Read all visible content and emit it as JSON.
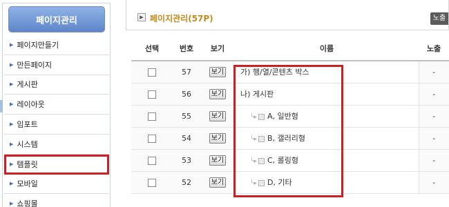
{
  "sidebar": {
    "title": "페이지관리",
    "items": [
      {
        "label": "페이지만들기"
      },
      {
        "label": "만든페이지"
      },
      {
        "label": "게시판"
      },
      {
        "label": "레이아웃"
      },
      {
        "label": "임포트"
      },
      {
        "label": "시스템"
      },
      {
        "label": "템플릿",
        "highlighted": true
      },
      {
        "label": "모바일"
      },
      {
        "label": "쇼핑몰"
      }
    ]
  },
  "header": {
    "title": "페이지관리(57P)",
    "right_button": "노출"
  },
  "table": {
    "columns": [
      "선택",
      "번호",
      "보기",
      "이름",
      "노출"
    ],
    "view_label": "보기",
    "rows": [
      {
        "num": "57",
        "name": "가) 행/열/콘텐츠 박스",
        "child": false,
        "expose": "-"
      },
      {
        "num": "56",
        "name": "나) 게시판",
        "child": false,
        "expose": "-"
      },
      {
        "num": "55",
        "name": "A, 일반형",
        "child": true,
        "expose": "-"
      },
      {
        "num": "54",
        "name": "B, 갤러리형",
        "child": true,
        "expose": "-"
      },
      {
        "num": "53",
        "name": "C, 롤링형",
        "child": true,
        "expose": "-"
      },
      {
        "num": "52",
        "name": "D, 기타",
        "child": true,
        "expose": "-"
      }
    ]
  },
  "colors": {
    "highlight": "#cc1f24",
    "title": "#c58a1a",
    "sidebar_header": "#6f95d3"
  }
}
